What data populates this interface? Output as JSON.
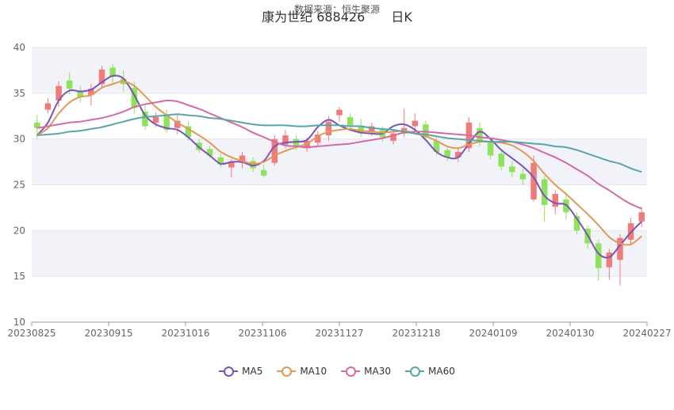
{
  "header": {
    "source": "数据来源：恒生聚源",
    "stock": "康为世纪 688426",
    "period": "日K"
  },
  "colors": {
    "up": "#f07b7b",
    "down": "#8ee25c",
    "ma5": "#7a55b8",
    "ma10": "#e09a55",
    "ma30": "#d46aa6",
    "ma60": "#5aa5a5",
    "band": "#f2f3f8",
    "grid": "#e4e6ee",
    "axis": "#666666"
  },
  "chart_data": {
    "type": "candlestick",
    "ylim": [
      10,
      40
    ],
    "yticks": [
      10,
      15,
      20,
      25,
      30,
      35,
      40
    ],
    "xtick_labels": [
      "20230825",
      "20230915",
      "20231016",
      "20231106",
      "20231127",
      "20231218",
      "20240109",
      "20240130",
      "20240227"
    ],
    "legend": [
      "MA5",
      "MA10",
      "MA30",
      "MA60"
    ],
    "series": [
      {
        "name": "MA5",
        "values": [
          30.4,
          31.8,
          34.2,
          35.3,
          35.2,
          35.4,
          36.2,
          36.9,
          36.6,
          34.8,
          32.6,
          31.6,
          31.2,
          31.0,
          30.2,
          29.1,
          28.2,
          27.3,
          27.5,
          27.5,
          27.1,
          27.6,
          29.2,
          29.6,
          29.7,
          29.9,
          31.3,
          32.1,
          31.5,
          31.0,
          30.7,
          30.6,
          30.6,
          31.4,
          31.6,
          31.0,
          29.9,
          28.6,
          28.0,
          28.0,
          29.5,
          30.8,
          30.0,
          28.8,
          27.9,
          27.0,
          25.8,
          23.8,
          23.0,
          22.8,
          21.3,
          19.5,
          17.5,
          17.1,
          18.4,
          19.8,
          21.0
        ]
      },
      {
        "name": "MA10",
        "values": [
          30.4,
          31.2,
          32.8,
          34.0,
          34.6,
          34.8,
          35.6,
          36.0,
          36.3,
          35.8,
          34.7,
          33.5,
          32.6,
          31.8,
          31.1,
          30.4,
          29.6,
          28.6,
          28.0,
          27.6,
          27.3,
          27.5,
          28.2,
          28.7,
          29.1,
          29.5,
          30.3,
          30.8,
          31.0,
          31.1,
          30.9,
          30.8,
          30.7,
          30.8,
          30.9,
          30.6,
          30.3,
          29.8,
          29.2,
          29.0,
          29.4,
          29.7,
          29.7,
          29.6,
          29.3,
          28.6,
          27.6,
          26.2,
          25.0,
          24.0,
          22.9,
          21.8,
          20.6,
          19.3,
          18.6,
          18.5,
          19.4
        ]
      },
      {
        "name": "MA30",
        "values": [
          31.2,
          31.4,
          31.6,
          31.8,
          31.9,
          32.1,
          32.3,
          32.6,
          33.0,
          33.5,
          33.8,
          34.0,
          34.2,
          34.1,
          33.7,
          33.3,
          32.8,
          32.3,
          31.8,
          31.3,
          30.7,
          30.2,
          29.7,
          29.3,
          29.2,
          29.1,
          29.2,
          29.3,
          29.4,
          29.5,
          29.7,
          29.9,
          30.1,
          30.4,
          30.7,
          30.8,
          30.8,
          30.7,
          30.6,
          30.5,
          30.4,
          30.2,
          30.1,
          29.9,
          29.7,
          29.4,
          29.0,
          28.5,
          28.0,
          27.4,
          26.7,
          26.0,
          25.1,
          24.4,
          23.6,
          22.9,
          22.4
        ]
      },
      {
        "name": "MA60",
        "values": [
          30.4,
          30.5,
          30.6,
          30.8,
          30.9,
          31.1,
          31.3,
          31.6,
          31.9,
          32.2,
          32.4,
          32.5,
          32.6,
          32.7,
          32.6,
          32.5,
          32.3,
          32.2,
          32.0,
          31.8,
          31.6,
          31.5,
          31.5,
          31.5,
          31.4,
          31.4,
          31.5,
          31.5,
          31.5,
          31.4,
          31.4,
          31.2,
          31.1,
          31.0,
          30.8,
          30.6,
          30.5,
          30.3,
          30.1,
          30.0,
          29.9,
          29.8,
          29.7,
          29.7,
          29.7,
          29.6,
          29.5,
          29.4,
          29.2,
          29.1,
          28.8,
          28.4,
          28.0,
          27.6,
          27.3,
          26.8,
          26.4
        ]
      }
    ],
    "candles": [
      {
        "o": 31.8,
        "c": 31.2,
        "h": 32.6,
        "l": 30.0
      },
      {
        "o": 33.2,
        "c": 33.9,
        "h": 34.5,
        "l": 32.8
      },
      {
        "o": 34.2,
        "c": 35.8,
        "h": 36.3,
        "l": 33.5
      },
      {
        "o": 36.4,
        "c": 35.5,
        "h": 37.3,
        "l": 34.9
      },
      {
        "o": 35.2,
        "c": 34.6,
        "h": 35.8,
        "l": 34.0
      },
      {
        "o": 34.8,
        "c": 35.5,
        "h": 36.0,
        "l": 33.7
      },
      {
        "o": 36.0,
        "c": 37.6,
        "h": 38.0,
        "l": 35.6
      },
      {
        "o": 37.8,
        "c": 36.8,
        "h": 38.2,
        "l": 36.0
      },
      {
        "o": 36.6,
        "c": 36.0,
        "h": 37.5,
        "l": 35.2
      },
      {
        "o": 35.6,
        "c": 33.4,
        "h": 36.3,
        "l": 32.8
      },
      {
        "o": 33.0,
        "c": 31.4,
        "h": 33.6,
        "l": 31.0
      },
      {
        "o": 31.8,
        "c": 32.4,
        "h": 32.9,
        "l": 31.3
      },
      {
        "o": 32.6,
        "c": 31.0,
        "h": 33.2,
        "l": 30.7
      },
      {
        "o": 31.2,
        "c": 32.0,
        "h": 32.7,
        "l": 30.5
      },
      {
        "o": 31.4,
        "c": 30.2,
        "h": 31.9,
        "l": 29.8
      },
      {
        "o": 29.6,
        "c": 28.8,
        "h": 30.0,
        "l": 28.5
      },
      {
        "o": 28.9,
        "c": 28.2,
        "h": 29.3,
        "l": 27.9
      },
      {
        "o": 28.0,
        "c": 27.2,
        "h": 28.4,
        "l": 26.9
      },
      {
        "o": 26.9,
        "c": 27.5,
        "h": 27.8,
        "l": 25.8
      },
      {
        "o": 27.4,
        "c": 28.2,
        "h": 28.6,
        "l": 26.8
      },
      {
        "o": 27.6,
        "c": 26.8,
        "h": 28.0,
        "l": 26.4
      },
      {
        "o": 26.6,
        "c": 26.0,
        "h": 27.2,
        "l": 25.8
      },
      {
        "o": 27.4,
        "c": 30.0,
        "h": 30.4,
        "l": 27.1
      },
      {
        "o": 29.4,
        "c": 30.4,
        "h": 31.0,
        "l": 29.0
      },
      {
        "o": 30.0,
        "c": 29.2,
        "h": 30.4,
        "l": 28.8
      },
      {
        "o": 29.0,
        "c": 29.8,
        "h": 30.2,
        "l": 28.6
      },
      {
        "o": 29.6,
        "c": 30.5,
        "h": 30.9,
        "l": 29.2
      },
      {
        "o": 30.4,
        "c": 31.9,
        "h": 32.5,
        "l": 29.8
      },
      {
        "o": 32.6,
        "c": 33.2,
        "h": 33.5,
        "l": 31.9
      },
      {
        "o": 32.4,
        "c": 31.5,
        "h": 32.8,
        "l": 31.0
      },
      {
        "o": 31.4,
        "c": 30.6,
        "h": 32.2,
        "l": 30.2
      },
      {
        "o": 30.8,
        "c": 31.4,
        "h": 31.8,
        "l": 30.3
      },
      {
        "o": 31.0,
        "c": 30.2,
        "h": 31.4,
        "l": 29.7
      },
      {
        "o": 29.8,
        "c": 30.6,
        "h": 31.0,
        "l": 29.4
      },
      {
        "o": 30.6,
        "c": 31.2,
        "h": 33.3,
        "l": 30.2
      },
      {
        "o": 31.4,
        "c": 32.0,
        "h": 32.8,
        "l": 30.8
      },
      {
        "o": 31.6,
        "c": 30.2,
        "h": 32.0,
        "l": 29.8
      },
      {
        "o": 29.8,
        "c": 28.6,
        "h": 30.2,
        "l": 28.2
      },
      {
        "o": 28.8,
        "c": 28.0,
        "h": 29.2,
        "l": 27.6
      },
      {
        "o": 28.0,
        "c": 28.6,
        "h": 29.0,
        "l": 27.5
      },
      {
        "o": 29.0,
        "c": 31.8,
        "h": 32.4,
        "l": 28.6
      },
      {
        "o": 31.2,
        "c": 29.8,
        "h": 31.8,
        "l": 29.2
      },
      {
        "o": 29.6,
        "c": 28.2,
        "h": 30.0,
        "l": 27.8
      },
      {
        "o": 28.4,
        "c": 27.0,
        "h": 28.8,
        "l": 26.6
      },
      {
        "o": 27.0,
        "c": 26.4,
        "h": 27.6,
        "l": 25.8
      },
      {
        "o": 26.2,
        "c": 25.6,
        "h": 26.8,
        "l": 25.0
      },
      {
        "o": 23.4,
        "c": 27.4,
        "h": 28.2,
        "l": 23.2
      },
      {
        "o": 25.6,
        "c": 22.8,
        "h": 26.0,
        "l": 21.0
      },
      {
        "o": 22.6,
        "c": 24.0,
        "h": 24.4,
        "l": 21.8
      },
      {
        "o": 23.4,
        "c": 22.0,
        "h": 24.2,
        "l": 21.2
      },
      {
        "o": 21.6,
        "c": 20.0,
        "h": 22.0,
        "l": 19.6
      },
      {
        "o": 20.2,
        "c": 18.6,
        "h": 20.6,
        "l": 18.0
      },
      {
        "o": 18.6,
        "c": 15.9,
        "h": 19.0,
        "l": 14.5
      },
      {
        "o": 16.0,
        "c": 17.6,
        "h": 18.0,
        "l": 14.6
      },
      {
        "o": 16.8,
        "c": 19.2,
        "h": 19.6,
        "l": 14.0
      },
      {
        "o": 19.0,
        "c": 20.8,
        "h": 21.4,
        "l": 18.4
      },
      {
        "o": 21.0,
        "c": 22.0,
        "h": 22.6,
        "l": 20.4
      }
    ]
  }
}
